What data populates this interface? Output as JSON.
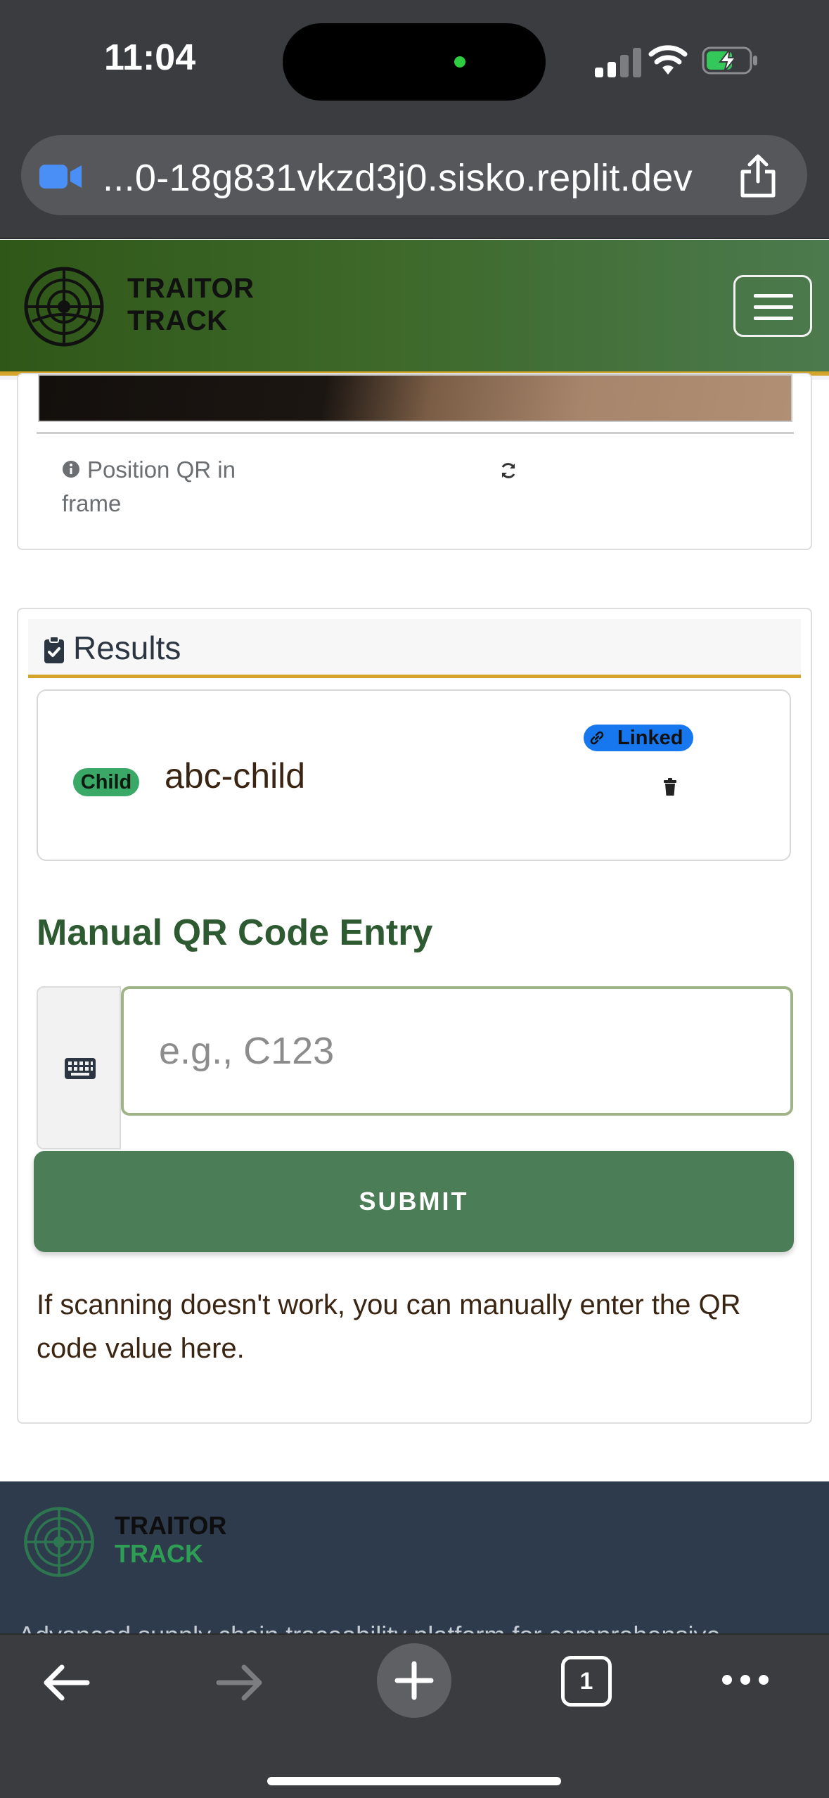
{
  "status_bar": {
    "time": "11:04"
  },
  "browser": {
    "url": "...0-18g831vkzd3j0.sisko.replit.dev",
    "tab_count": "1"
  },
  "header": {
    "brand_line1": "TRAITOR",
    "brand_line2": "TRACK"
  },
  "scanner": {
    "hint": "Position QR in frame"
  },
  "results": {
    "title": "Results",
    "items": [
      {
        "type_badge": "Child",
        "code": "abc-child",
        "status_badge": "Linked"
      }
    ]
  },
  "manual_entry": {
    "title": "Manual QR Code Entry",
    "placeholder": "e.g., C123",
    "value": "",
    "submit_label": "SUBMIT",
    "helper_text": "If scanning doesn't work, you can manually enter the QR code value here."
  },
  "footer": {
    "brand_line1": "TRAITOR",
    "brand_line2": "TRACK",
    "description": "Advanced supply chain traceability platform for comprehensive"
  },
  "colors": {
    "header_green": "#3e6a2c",
    "accent_gold": "#d4a52a",
    "submit_green": "#4b7d57",
    "child_badge": "#3aa867",
    "linked_badge": "#1677ee",
    "footer_bg": "#2d3b4c"
  }
}
